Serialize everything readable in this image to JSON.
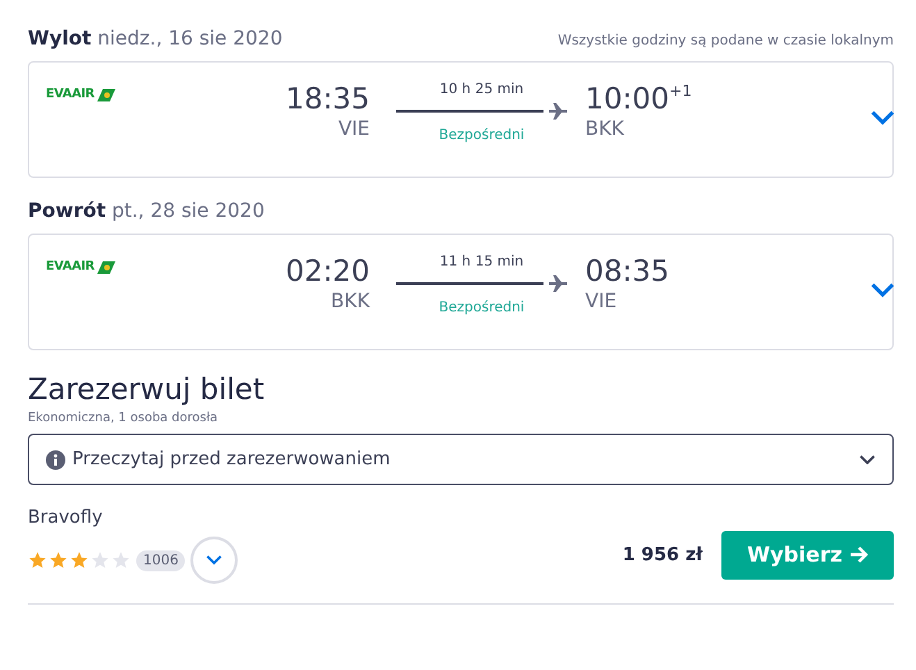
{
  "legs": [
    {
      "label": "Wylot",
      "date": "niedz., 16 sie 2020",
      "note": "Wszystkie godziny są podane w czasie lokalnym",
      "airline": "EVAAIR",
      "dep_time": "18:35",
      "dep_airport": "VIE",
      "duration": "10 h 25 min",
      "stops": "Bezpośredni",
      "arr_time": "10:00",
      "arr_offset": "+1",
      "arr_airport": "BKK"
    },
    {
      "label": "Powrót",
      "date": "pt., 28 sie 2020",
      "airline": "EVAAIR",
      "dep_time": "02:20",
      "dep_airport": "BKK",
      "duration": "11 h 15 min",
      "stops": "Bezpośredni",
      "arr_time": "08:35",
      "arr_airport": "VIE"
    }
  ],
  "booking": {
    "title": "Zarezerwuj bilet",
    "subtitle": "Ekonomiczna, 1 osoba dorosła",
    "notice": "Przeczytaj przed zarezerwowaniem",
    "provider": "Bravofly",
    "stars": 3,
    "reviews": "1006",
    "price": "1 956 zł",
    "button": "Wybierz"
  }
}
